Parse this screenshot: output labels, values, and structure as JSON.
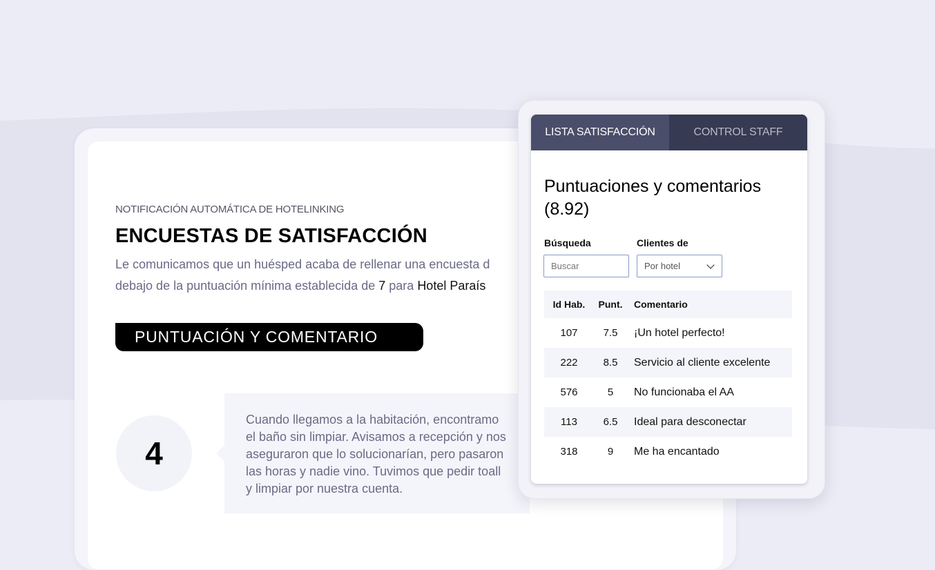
{
  "email": {
    "notification_label": "NOTIFICACIÓN AUTOMÁTICA DE HOTELINKING",
    "title": "ENCUESTAS DE SATISFACCIÓN",
    "intro_line1": "Le comunicamos que un huésped acaba de rellenar una encuesta d",
    "intro_line2_prefix": "debajo de la puntuación mínima establecida de ",
    "min_score": "7",
    "intro_line2_mid": " para ",
    "hotel_name": "Hotel Paraís",
    "section_label": "PUNTUACIÓN  Y COMENTARIO",
    "score": "4",
    "comment": "Cuando llegamos a la habitación, encontramo\nel baño sin limpiar. Avisamos a recepción y nos\naseguraron que lo solucionarían, pero pasaron\nlas horas y nadie vino. Tuvimos que pedir toall\ny limpiar por nuestra cuenta."
  },
  "panel": {
    "tabs": [
      {
        "label": "LISTA SATISFACCIÓN",
        "active": true
      },
      {
        "label": "CONTROL STAFF",
        "active": false
      }
    ],
    "heading": "Puntuaciones y comentarios (8.92)",
    "search_label": "Búsqueda",
    "search_placeholder": "Buscar",
    "filter_label": "Clientes de",
    "filter_value": "Por hotel",
    "table": {
      "headers": [
        "Id Hab.",
        "Punt.",
        "Comentario"
      ],
      "rows": [
        {
          "room": "107",
          "score": "7.5",
          "comment": "¡Un hotel perfecto!"
        },
        {
          "room": "222",
          "score": "8.5",
          "comment": "Servicio al cliente excelente"
        },
        {
          "room": "576",
          "score": "5",
          "comment": "No funcionaba el AA"
        },
        {
          "room": "113",
          "score": "6.5",
          "comment": "Ideal para desconectar"
        },
        {
          "room": "318",
          "score": "9",
          "comment": "Me ha encantado"
        }
      ]
    }
  },
  "colors": {
    "tab_active_bg": "#4a4e6a",
    "tab_bg": "#363a52",
    "page_bg": "#ececf6"
  }
}
